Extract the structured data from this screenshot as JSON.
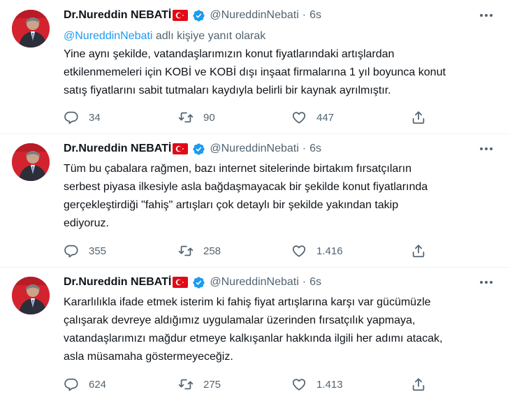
{
  "colors": {
    "accent": "#1d9bf0",
    "text": "#0f1419",
    "muted": "#536471",
    "flag_red": "#e30a17"
  },
  "tweets": [
    {
      "author_name": "Dr.Nureddin NEBATİ",
      "handle": "@NureddinNebati",
      "separator": "·",
      "time": "6s",
      "reply_mention": "@NureddinNebati",
      "reply_suffix": " adlı kişiye yanıt olarak",
      "lines": [
        "Yine aynı şekilde, vatandaşlarımızın konut fiyatlarındaki artışlardan",
        "etkilenmemeleri için KOBİ ve KOBİ dışı inşaat firmalarına 1 yıl boyunca konut",
        "satış fiyatlarını sabit tutmaları kaydıyla belirli bir kaynak ayrılmıştır."
      ],
      "replies": "34",
      "retweets": "90",
      "likes": "447"
    },
    {
      "author_name": "Dr.Nureddin NEBATİ",
      "handle": "@NureddinNebati",
      "separator": "·",
      "time": "6s",
      "lines": [
        "Tüm bu çabalara rağmen, bazı internet sitelerinde birtakım fırsatçıların",
        "serbest piyasa ilkesiyle asla bağdaşmayacak bir şekilde konut fiyatlarında",
        "gerçekleştirdiği \"fahiş\" artışları çok detaylı bir şekilde yakından takip",
        "ediyoruz."
      ],
      "replies": "355",
      "retweets": "258",
      "likes": "1.416"
    },
    {
      "author_name": "Dr.Nureddin NEBATİ",
      "handle": "@NureddinNebati",
      "separator": "·",
      "time": "6s",
      "lines": [
        "Kararlılıkla ifade etmek isterim ki fahiş fiyat artışlarına karşı var gücümüzle",
        "çalışarak devreye aldığımız uygulamalar üzerinden fırsatçılık yapmaya,",
        "vatandaşlarımızı mağdur etmeye kalkışanlar hakkında ilgili her adımı atacak,",
        "asla müsamaha göstermeyeceğiz."
      ],
      "replies": "624",
      "retweets": "275",
      "likes": "1.413"
    }
  ]
}
